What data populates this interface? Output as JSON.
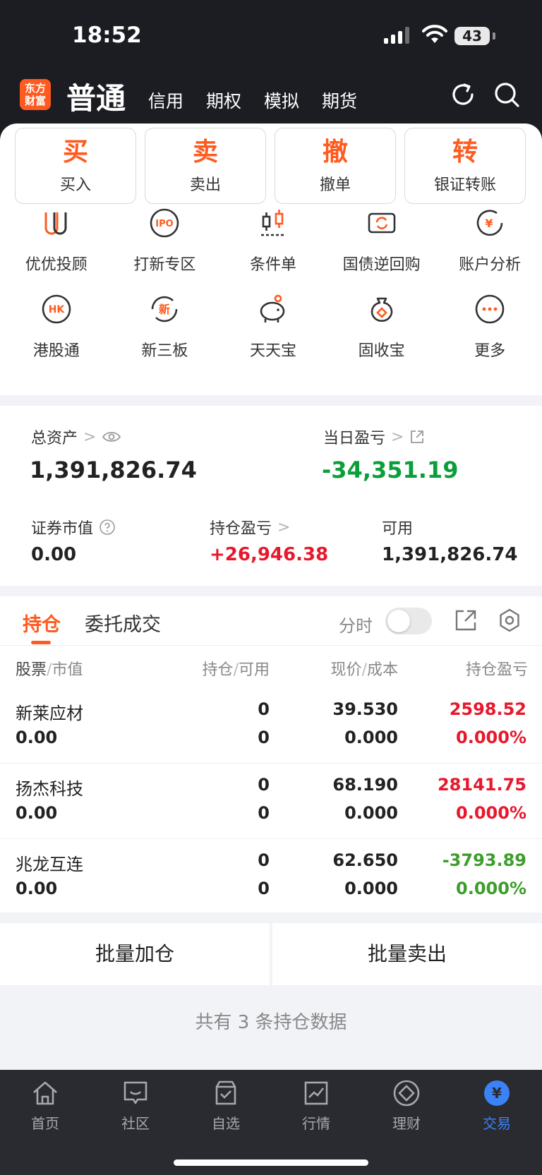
{
  "status": {
    "time": "18:52",
    "battery": "43"
  },
  "header": {
    "logo": [
      "东方",
      "财富"
    ],
    "active_tab": "普通",
    "tabs": [
      "信用",
      "期权",
      "模拟",
      "期货"
    ]
  },
  "actions": [
    {
      "big": "买",
      "small": "买入"
    },
    {
      "big": "卖",
      "small": "卖出"
    },
    {
      "big": "撤",
      "small": "撤单"
    },
    {
      "big": "转",
      "small": "银证转账"
    }
  ],
  "grid_row1": [
    "优优投顾",
    "打新专区",
    "条件单",
    "国债逆回购",
    "账户分析"
  ],
  "grid_row2": [
    "港股通",
    "新三板",
    "天天宝",
    "固收宝",
    "更多"
  ],
  "icon_texts": {
    "ipo": "IPO",
    "hk": "HK",
    "new": "新",
    "yen": "¥"
  },
  "assets": {
    "total_label": "总资产",
    "total_value": "1,391,826.74",
    "day_pl_label": "当日盈亏",
    "day_pl_value": "-34,351.19",
    "sec_value_label": "证券市值",
    "sec_value": "0.00",
    "pos_pl_label": "持仓盈亏",
    "pos_pl_value": "+26,946.38",
    "available_label": "可用",
    "available_value": "1,391,826.74"
  },
  "holdings": {
    "tab_active": "持仓",
    "tab_other": "委托成交",
    "fenshi": "分时",
    "head": {
      "c1a": "股票",
      "c1b": "市值",
      "c2a": "持仓",
      "c2b": "可用",
      "c3a": "现价",
      "c3b": "成本",
      "c4": "持仓盈亏"
    },
    "rows": [
      {
        "name": "新莱应材",
        "mv": "0.00",
        "pos": "0",
        "avl": "0",
        "price": "39.530",
        "cost": "0.000",
        "pl": "2598.52",
        "plp": "0.000%",
        "color": "red"
      },
      {
        "name": "扬杰科技",
        "mv": "0.00",
        "pos": "0",
        "avl": "0",
        "price": "68.190",
        "cost": "0.000",
        "pl": "28141.75",
        "plp": "0.000%",
        "color": "red"
      },
      {
        "name": "兆龙互连",
        "mv": "0.00",
        "pos": "0",
        "avl": "0",
        "price": "62.650",
        "cost": "0.000",
        "pl": "-3793.89",
        "plp": "0.000%",
        "color": "green"
      }
    ]
  },
  "batch": {
    "add": "批量加仓",
    "sell": "批量卖出"
  },
  "count_text": "共有 3 条持仓数据",
  "nav": [
    {
      "label": "首页"
    },
    {
      "label": "社区"
    },
    {
      "label": "自选"
    },
    {
      "label": "行情"
    },
    {
      "label": "理财"
    },
    {
      "label": "交易"
    }
  ],
  "colors": {
    "accent": "#ff5a1f",
    "up": "#e8182c",
    "down": "#3c9e2b",
    "nav_active": "#3b82f6"
  }
}
